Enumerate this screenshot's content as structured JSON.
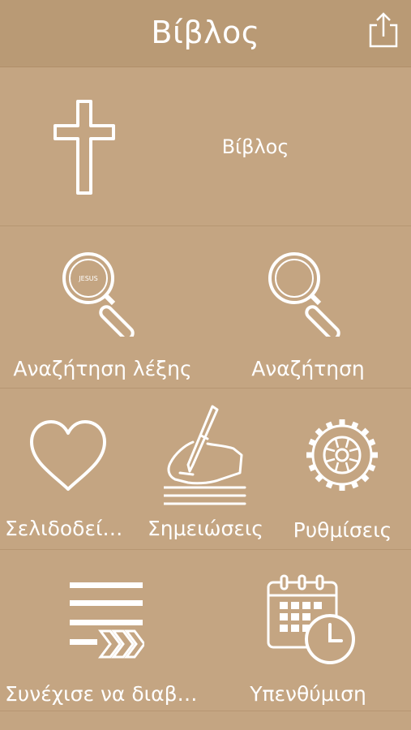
{
  "header": {
    "title": "Βίβλος",
    "share_icon": "share-icon"
  },
  "menu": {
    "bible": {
      "label": "Βίβλος",
      "icon": "cross-icon"
    },
    "word_search": {
      "label": "Αναζήτηση λέξης",
      "icon": "jesus-magnifier-icon",
      "icon_text": [
        "JESUS"
      ]
    },
    "search": {
      "label": "Αναζήτηση",
      "icon": "magnifier-icon"
    },
    "bookmarks": {
      "label": "Σελιδοδεί…",
      "icon": "heart-icon"
    },
    "notes": {
      "label": "Σημειώσεις",
      "icon": "writing-hand-icon"
    },
    "settings": {
      "label": "Ρυθμίσεις",
      "icon": "gear-icon"
    },
    "continue_reading": {
      "label": "Συνέχισε να διαβ…",
      "icon": "continue-list-icon"
    },
    "reminder": {
      "label": "Υπενθύμιση",
      "icon": "calendar-clock-icon"
    }
  },
  "colors": {
    "background": "#c4a582",
    "header": "#b99a75",
    "foreground": "#ffffff"
  }
}
